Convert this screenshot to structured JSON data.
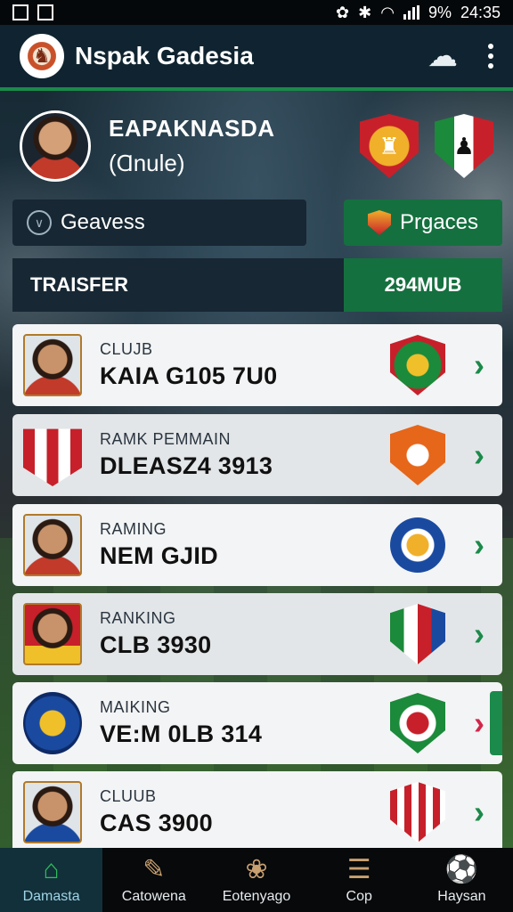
{
  "status_bar": {
    "battery": "9%",
    "time": "24:35"
  },
  "header": {
    "title": "Nspak Gadesia"
  },
  "profile": {
    "name": "EAPAKNASDA",
    "subtitle": "(Ɑnule)"
  },
  "actions": {
    "left_label": "Geavess",
    "right_label": "Prgaces"
  },
  "transfer": {
    "label": "TRAISFER",
    "value": "294MUB"
  },
  "cards": [
    {
      "label": "CLUJB",
      "value": "KAIA G105 7U0"
    },
    {
      "label": "RAMK PEMMAIN",
      "value": "DLEASZ4 3913"
    },
    {
      "label": "RAMING",
      "value": "NEM GJID"
    },
    {
      "label": "RANKING",
      "value": "CLB 3930"
    },
    {
      "label": "MAIKING",
      "value": "VE:M 0LB 314"
    },
    {
      "label": "CLUUB",
      "value": "CAS 3900"
    }
  ],
  "nav": [
    {
      "label": "Damasta",
      "icon": "home-icon"
    },
    {
      "label": "Catowena",
      "icon": "edit-icon"
    },
    {
      "label": "Eotenyago",
      "icon": "cat-icon"
    },
    {
      "label": "Cop",
      "icon": "list-icon"
    },
    {
      "label": "Haysan",
      "icon": "soccer-ball-icon"
    }
  ],
  "colors": {
    "accent_green": "#1b8a4a",
    "dark_panel": "#172733",
    "chevron_alert": "#d2264a"
  }
}
